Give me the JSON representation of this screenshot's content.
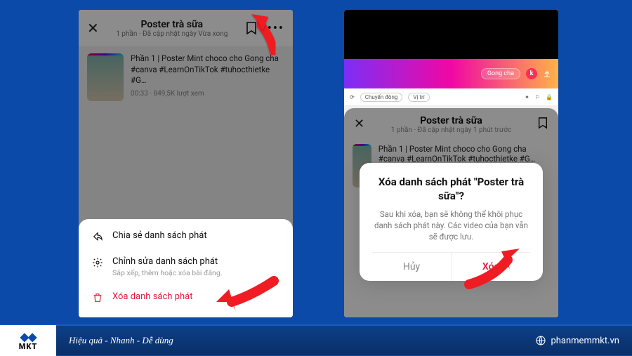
{
  "left": {
    "header": {
      "title": "Poster trà sữa",
      "subtitle": "1 phần · Đã cập nhật ngày Vừa xong"
    },
    "card": {
      "title": "Phần 1 | Poster Mint choco cho Gong cha #canva #LearnOnTikTok #tuhocthietke #G…",
      "meta": "00:33 · 849,5K lượt xem"
    },
    "sheet": {
      "share": "Chia sẻ danh sách phát",
      "edit": "Chỉnh sửa danh sách phát",
      "edit_sub": "Sắp xếp, thêm hoặc xóa bài đăng.",
      "delete": "Xóa danh sách phát"
    }
  },
  "right": {
    "grad": {
      "pill": "Gong cha",
      "avatar": "k"
    },
    "toolbar": {
      "chip1": "Chuyển động",
      "chip2": "Vị trí"
    },
    "header": {
      "title": "Poster trà sữa",
      "subtitle": "1 phần · Đã cập nhật ngày 1 phút trước"
    },
    "card": {
      "line": "Phần 1 | Poster Mint choco cho Gong cha #canva #LearnOnTikTok #tuhocthietke #G…"
    },
    "confirm": {
      "title": "Xóa danh sách phát \"Poster trà sữa\"?",
      "body": "Sau khi xóa, bạn sẽ không thể khôi phục danh sách phát này. Các video của bạn vẫn sẽ được lưu.",
      "cancel": "Hủy",
      "delete": "Xóa"
    }
  },
  "footer": {
    "logo_text": "MKT",
    "tagline": "Hiệu quả - Nhanh - Dễ dùng",
    "site": "phanmemmkt.vn"
  }
}
